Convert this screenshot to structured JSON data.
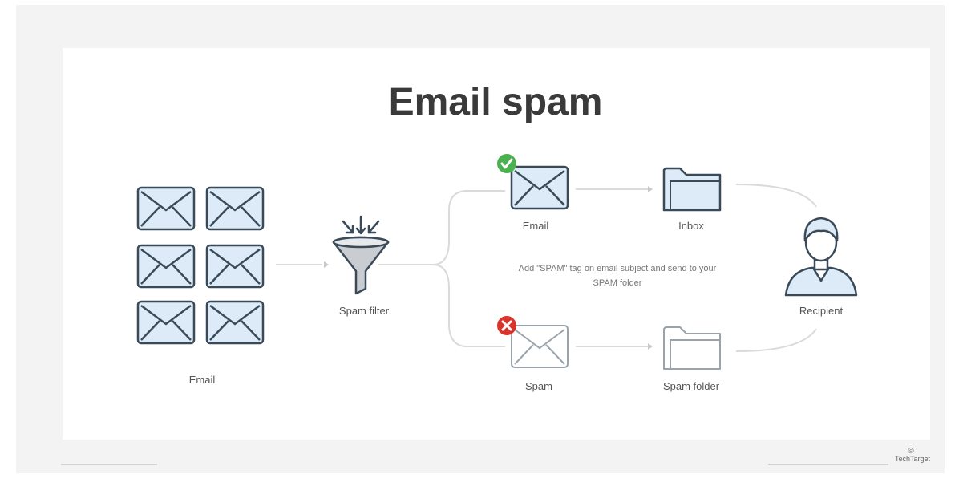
{
  "title": "Email spam",
  "labels": {
    "email_group": "Email",
    "spam_filter": "Spam filter",
    "email": "Email",
    "inbox": "Inbox",
    "spam": "Spam",
    "spam_folder": "Spam folder",
    "recipient": "Recipient"
  },
  "note": "Add \"SPAM\" tag on email subject and send to your SPAM folder",
  "logo": "TechTarget",
  "colors": {
    "envelope_fill": "#dcebf7",
    "envelope_stroke": "#3a4a58",
    "check": "#4caf50",
    "cross": "#d9342b",
    "line": "#d8d8d8"
  },
  "icons": {
    "check": "check-icon",
    "cross": "cross-icon",
    "funnel": "funnel-icon",
    "folder": "folder-icon",
    "person": "person-icon",
    "envelope": "envelope-icon"
  }
}
